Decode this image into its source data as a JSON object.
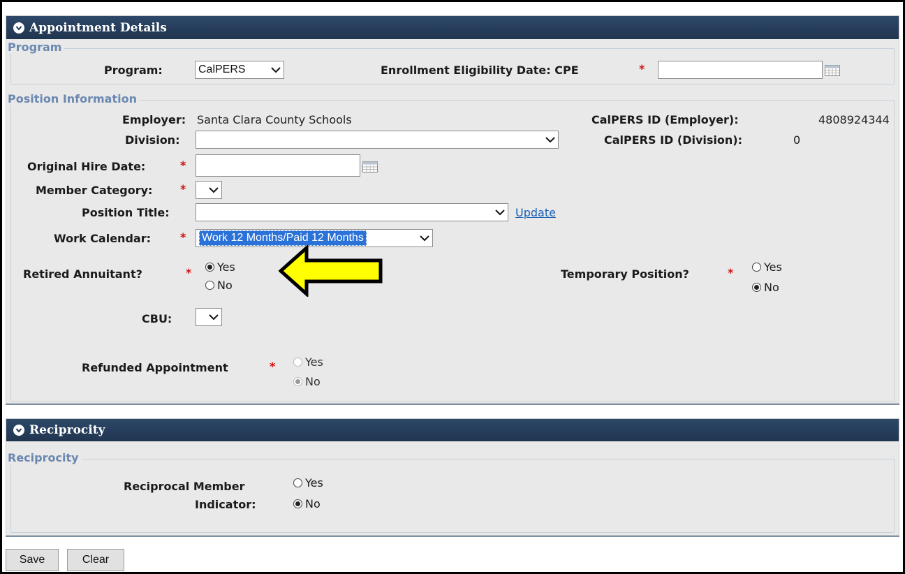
{
  "appointment": {
    "header": "Appointment Details",
    "program_legend": "Program",
    "program_label": "Program:",
    "program_value": "CalPERS",
    "eed_label": "Enrollment Eligibility Date: CPE",
    "required_mark": "*",
    "position_legend": "Position Information",
    "employer_label": "Employer:",
    "employer_value": "Santa Clara County Schools",
    "calpers_id_employer_label": "CalPERS ID (Employer):",
    "calpers_id_employer_value": "4808924344",
    "division_label": "Division:",
    "division_value": "",
    "calpers_id_division_label": "CalPERS ID (Division):",
    "calpers_id_division_value": "0",
    "hire_date_label": "Original Hire Date:",
    "member_category_label": "Member Category:",
    "position_title_label": "Position Title:",
    "update_link": "Update",
    "work_calendar_label": "Work Calendar:",
    "work_calendar_value": "Work 12 Months/Paid 12 Months",
    "retired_label": "Retired Annuitant?",
    "temporary_label": "Temporary Position?",
    "cbu_label": "CBU:",
    "refunded_label": "Refunded Appointment",
    "yes": "Yes",
    "no": "No",
    "selections": {
      "retired_annuitant": "Yes",
      "temporary_position": "No",
      "refunded_appointment": "No"
    }
  },
  "reciprocity": {
    "header": "Reciprocity",
    "legend": "Reciprocity",
    "indicator_label_line1": "Reciprocal Member",
    "indicator_label_line2": "Indicator:",
    "yes": "Yes",
    "no": "No",
    "selection": "No"
  },
  "actions": {
    "save": "Save",
    "clear": "Clear"
  },
  "colors": {
    "header_bg": "#20354f",
    "required": "#d01010",
    "legend": "#6b88b0",
    "arrow_fill": "#ffff00",
    "selected_highlight": "#2a72d8"
  },
  "icons": {
    "collapse": "chevron-circle-down-icon",
    "calendar": "calendar-icon",
    "pointer": "arrow-left-icon"
  }
}
